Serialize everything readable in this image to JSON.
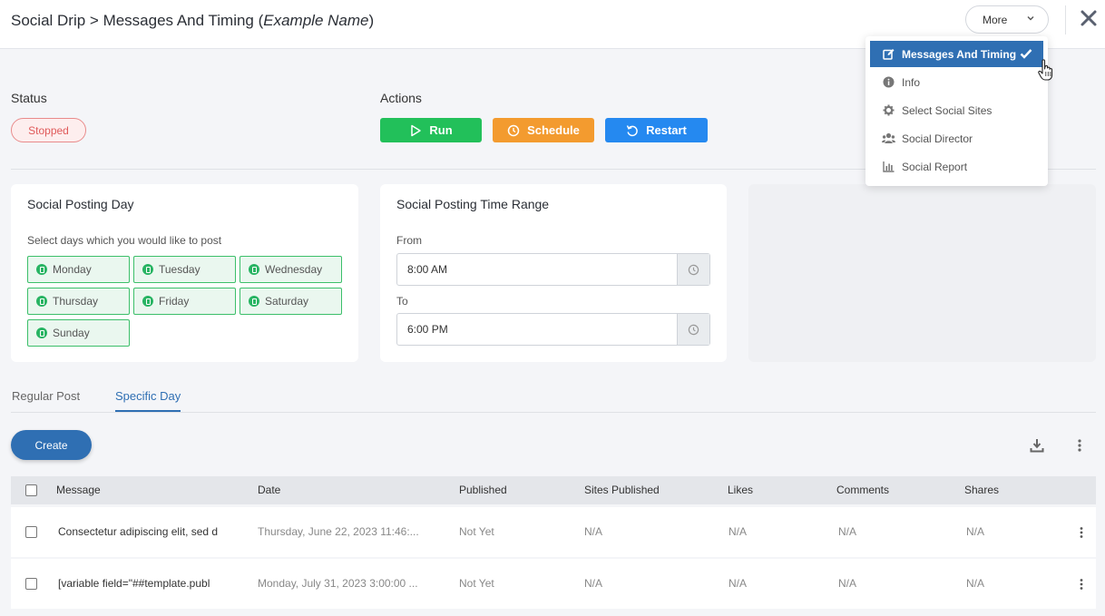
{
  "header": {
    "title_prefix": "Social Drip > Messages And Timing (",
    "title_name": "Example Name",
    "title_suffix": ")",
    "more_label": "More"
  },
  "status": {
    "label": "Status",
    "value": "Stopped"
  },
  "actions": {
    "label": "Actions",
    "run": "Run",
    "schedule": "Schedule",
    "restart": "Restart"
  },
  "posting_day": {
    "title": "Social Posting Day",
    "instruction": "Select days which you would like to post",
    "days": [
      "Monday",
      "Tuesday",
      "Wednesday",
      "Thursday",
      "Friday",
      "Saturday",
      "Sunday"
    ]
  },
  "time_range": {
    "title": "Social Posting Time Range",
    "from_label": "From",
    "from_value": "8:00 AM",
    "to_label": "To",
    "to_value": "6:00 PM"
  },
  "tabs": [
    "Regular Post",
    "Specific Day"
  ],
  "create_label": "Create",
  "table": {
    "columns": [
      "Message",
      "Date",
      "Published",
      "Sites Published",
      "Likes",
      "Comments",
      "Shares"
    ],
    "rows": [
      [
        "Consectetur adipiscing elit, sed d",
        "Thursday, June 22, 2023 11:46:...",
        "Not Yet",
        "N/A",
        "N/A",
        "N/A",
        "N/A"
      ],
      [
        "[variable field=\"##template.publ",
        "Monday, July 31, 2023 3:00:00 ...",
        "Not Yet",
        "N/A",
        "N/A",
        "N/A",
        "N/A"
      ]
    ]
  },
  "menu": {
    "items": [
      "Messages And Timing",
      "Info",
      "Select Social Sites",
      "Social Director",
      "Social Report"
    ],
    "icons": [
      "edit-icon",
      "info-icon",
      "gear-icon",
      "users-icon",
      "bar-chart-icon"
    ]
  },
  "colors": {
    "primary": "#2f6fb3",
    "run": "#22c05a",
    "schedule": "#f39b2f",
    "restart": "#2589f0",
    "stopped": "#e05a5a"
  }
}
